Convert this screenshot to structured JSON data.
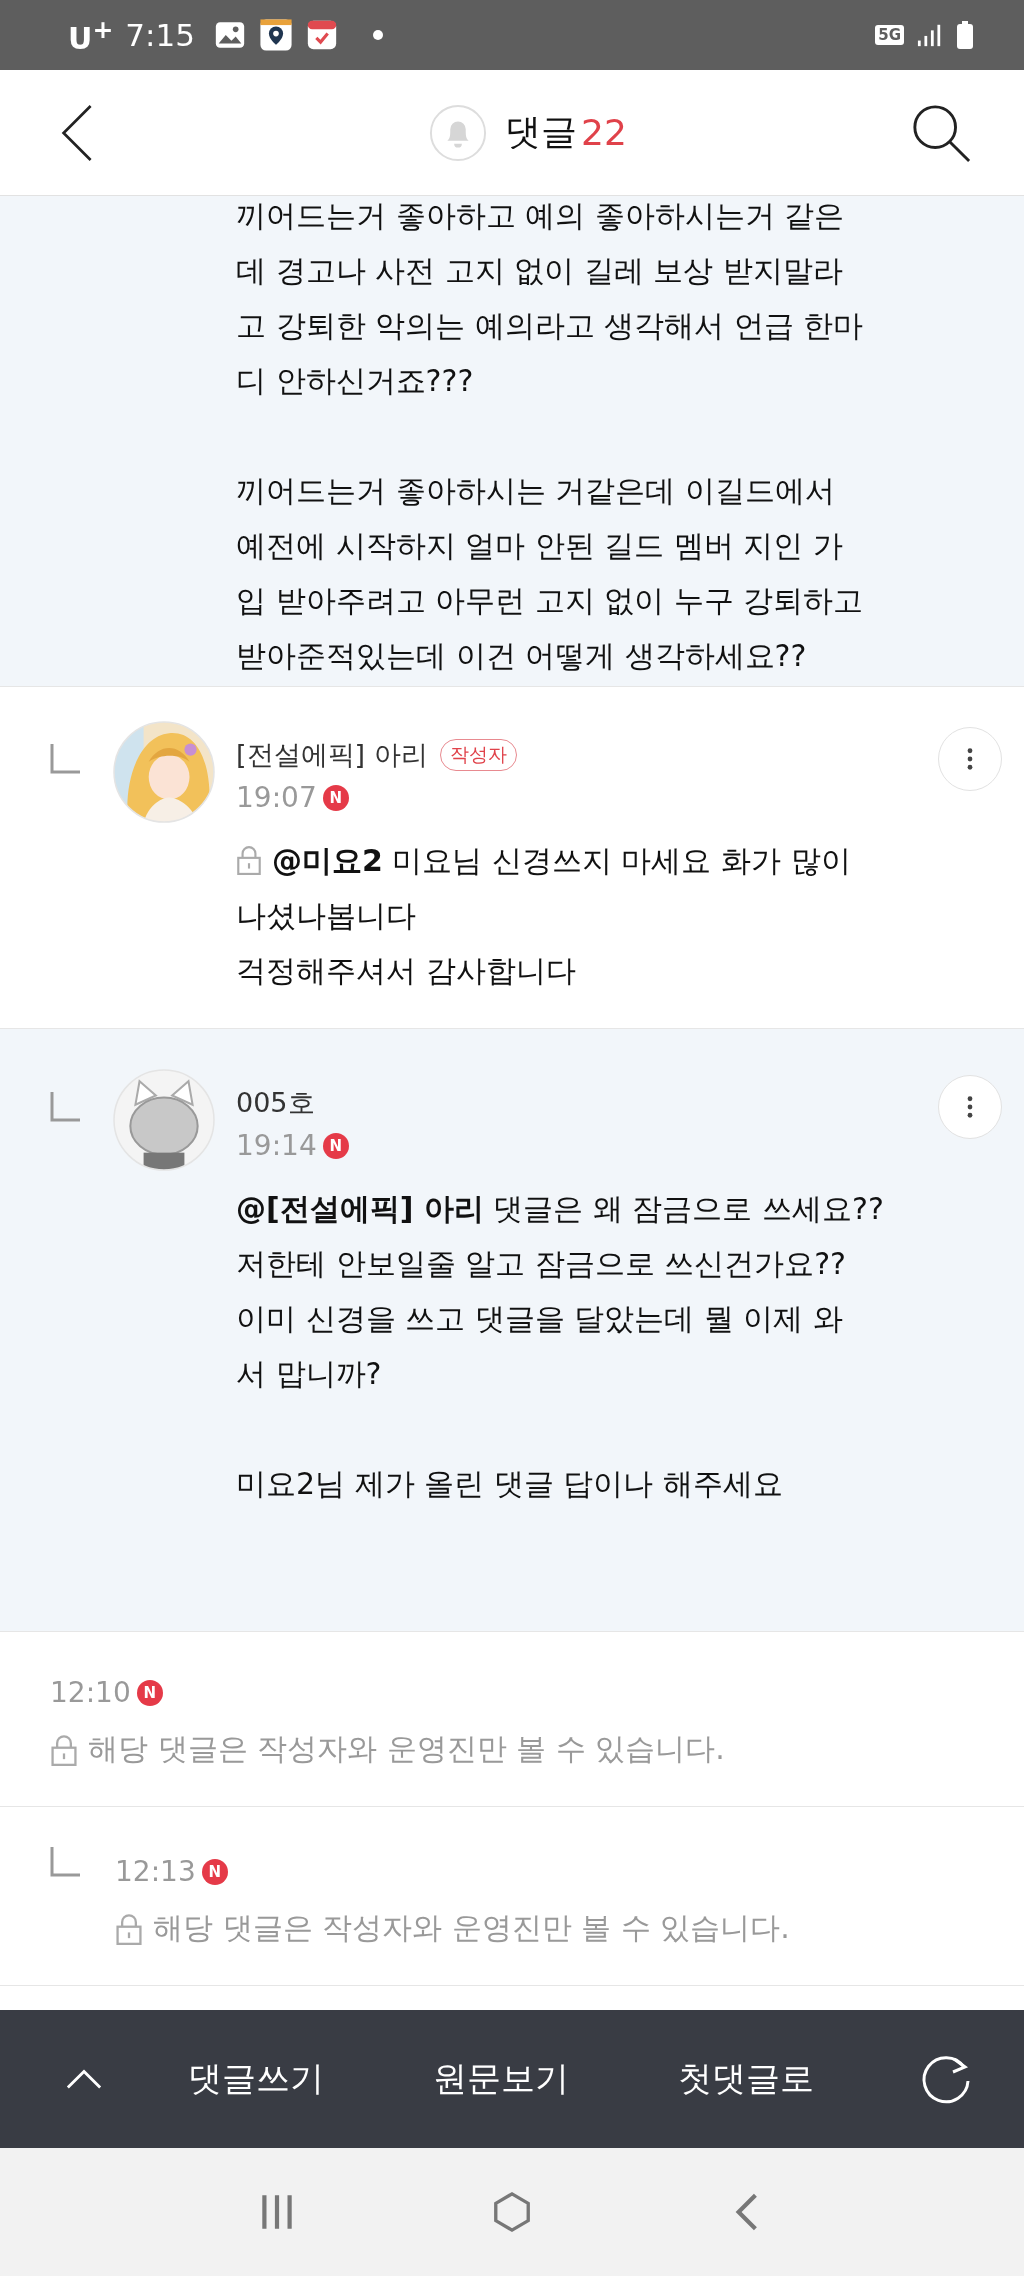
{
  "status_bar": {
    "carrier": "U$^{+}$",
    "time": "7:15",
    "network": "5G"
  },
  "header": {
    "title": "댓글",
    "count": "22"
  },
  "comments": [
    {
      "kind": "continued",
      "reply": false,
      "highlighted": true,
      "text": "끼어드는거 좋아하고 예의 좋아하시는거 같은\n데 경고나 사전 고지 없이 길레 보상 받지말라\n고 강퇴한 악의는 예의라고 생각해서 언급 한마\n디 안하신거죠???\n\n끼어드는거 좋아하시는 거같은데 이길드에서\n예전에 시작하지 얼마 안된 길드 멤버 지인 가\n입 받아주려고 아무런 고지 없이 누구 강퇴하고\n받아준적있는데 이건 어떻게 생각하세요??"
    },
    {
      "kind": "full",
      "reply": true,
      "highlighted": false,
      "author": "[전설에픽] 아리",
      "author_badge": "작성자",
      "time": "19:07",
      "new_badge": "N",
      "locked": true,
      "text": "**@미요2** 미요님 신경쓰지 마세요 화가 많이\n나셨나봅니다\n걱정해주셔서 감사합니다"
    },
    {
      "kind": "full",
      "reply": true,
      "highlighted": true,
      "author": "005호",
      "time": "19:14",
      "new_badge": "N",
      "locked": false,
      "text": "**@[전설에픽] 아리** 댓글은 왜 잠금으로 쓰세요??\n저한테 안보일줄 알고 잠금으로 쓰신건가요??\n이미 신경을 쓰고 댓글을 달았는데 뭘 이제 와\n서 맙니까?\n\n미요2님 제가 올린 댓글 답이나 해주세요"
    },
    {
      "kind": "hidden",
      "reply": false,
      "highlighted": false,
      "time": "12:10",
      "new_badge": "N",
      "text": "해당 댓글은 작성자와 운영진만 볼 수 있습니다."
    },
    {
      "kind": "hidden",
      "reply": true,
      "highlighted": false,
      "time": "12:13",
      "new_badge": "N",
      "text": "해당 댓글은 작성자와 운영진만 볼 수 있습니다."
    }
  ],
  "toolbar": {
    "buttons": [
      "댓글쓰기",
      "원문보기",
      "첫댓글로"
    ]
  }
}
